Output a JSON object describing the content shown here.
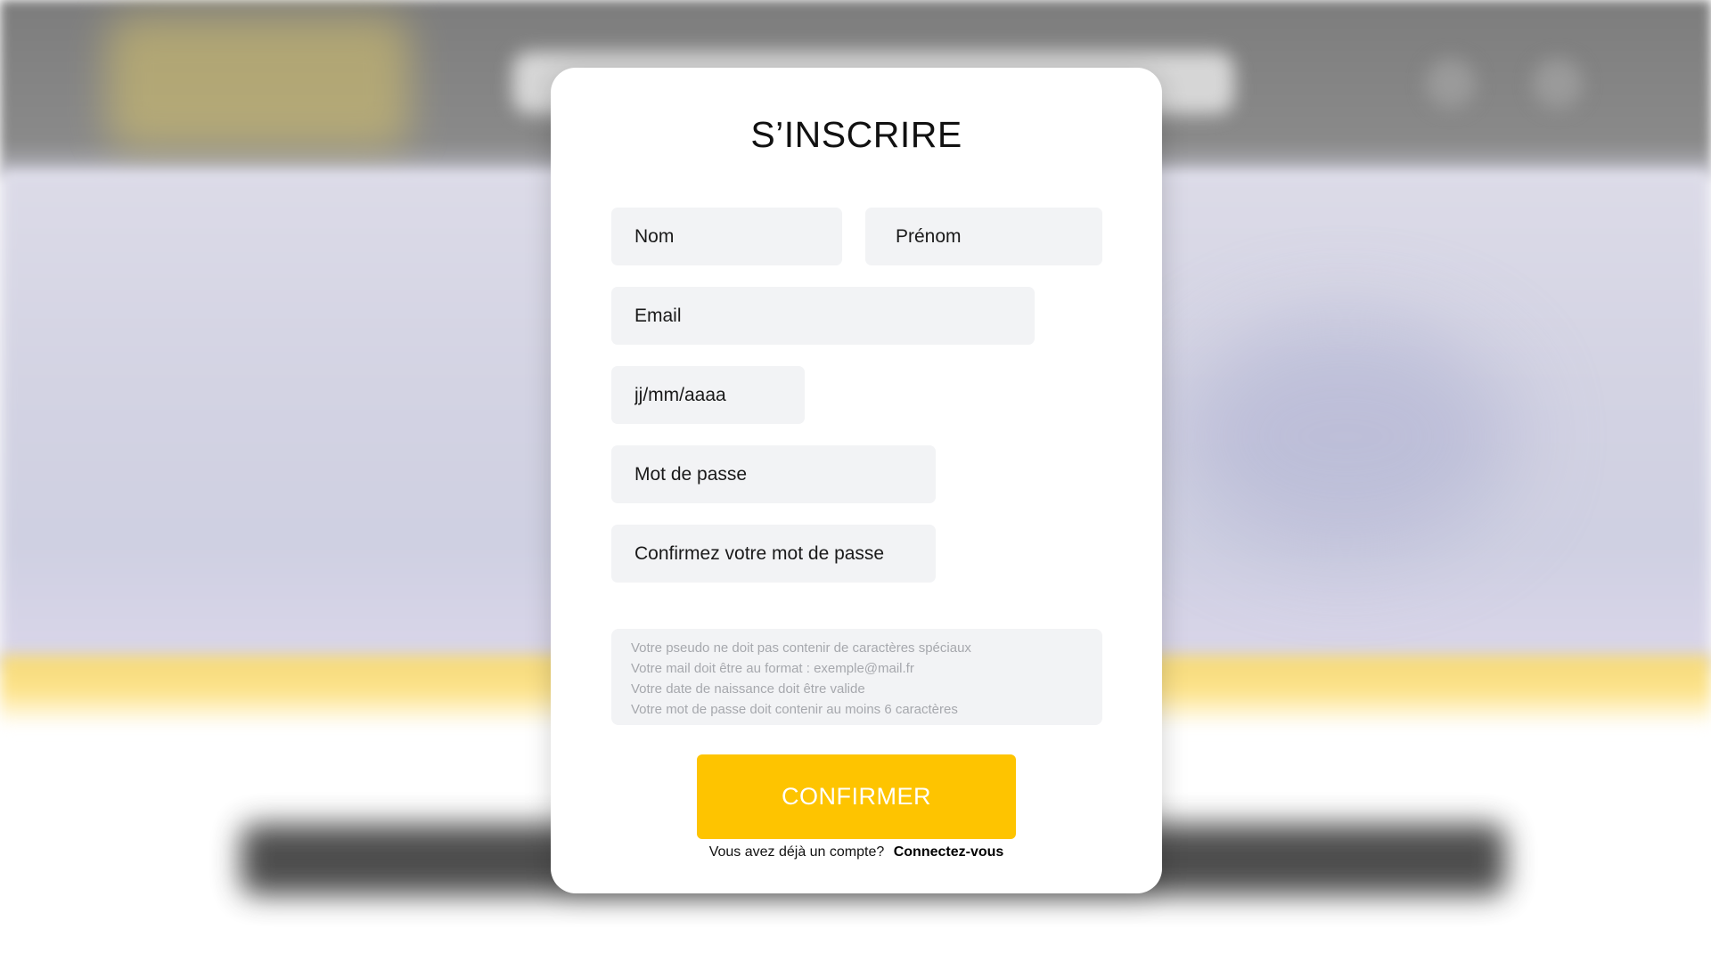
{
  "modal": {
    "title": "S’INSCRIRE",
    "fields": {
      "nom": {
        "placeholder": "Nom",
        "value": ""
      },
      "prenom": {
        "placeholder": "Prénom",
        "value": ""
      },
      "email": {
        "placeholder": "Email",
        "value": ""
      },
      "birthdate": {
        "placeholder": "jj/mm/aaaa",
        "value": ""
      },
      "password": {
        "placeholder": "Mot de passe",
        "value": ""
      },
      "password_confirm": {
        "placeholder": "Confirmez votre mot de passe",
        "value": ""
      }
    },
    "rules": [
      "Votre pseudo ne doit pas contenir de caractères spéciaux",
      "Votre mail doit être au format : exemple@mail.fr",
      "Votre date de naissance doit être valide",
      "Votre mot de passe doit contenir au moins 6 caractères"
    ],
    "confirm_label": "CONFIRMER",
    "login_prompt": "Vous avez déjà un compte?",
    "login_link": "Connectez-vous"
  },
  "colors": {
    "accent": "#fec400",
    "field_bg": "#f2f3f5",
    "rule_text": "#a6a8ad"
  },
  "icons": {
    "background_header_icons": [
      "search-icon",
      "user-icon"
    ]
  }
}
